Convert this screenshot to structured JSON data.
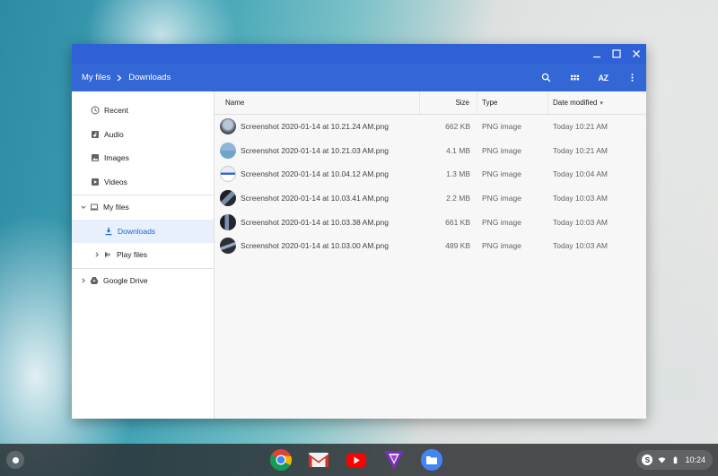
{
  "window": {
    "controls": {
      "minimize_icon": "minimize-icon",
      "maximize_icon": "maximize-icon",
      "close_icon": "close-icon"
    }
  },
  "breadcrumb": [
    "My files",
    "Downloads"
  ],
  "toolbar": {
    "az_label": "AZ",
    "icons": [
      "search-icon",
      "grid-view-icon",
      "sort-az-icon",
      "more-vert-icon"
    ]
  },
  "sidebar": {
    "recent": "Recent",
    "audio": "Audio",
    "images": "Images",
    "videos": "Videos",
    "my_files": "My files",
    "downloads": "Downloads",
    "play_files": "Play files",
    "google_drive": "Google Drive"
  },
  "columns": {
    "name": "Name",
    "size": "Size",
    "type": "Type",
    "date": "Date modified"
  },
  "files": [
    {
      "name": "Screenshot 2020-01-14 at 10.21.24 AM.png",
      "size": "662 KB",
      "type": "PNG image",
      "date": "Today 10:21 AM"
    },
    {
      "name": "Screenshot 2020-01-14 at 10.21.03 AM.png",
      "size": "4.1 MB",
      "type": "PNG image",
      "date": "Today 10:21 AM"
    },
    {
      "name": "Screenshot 2020-01-14 at 10.04.12 AM.png",
      "size": "1.3 MB",
      "type": "PNG image",
      "date": "Today 10:04 AM"
    },
    {
      "name": "Screenshot 2020-01-14 at 10.03.41 AM.png",
      "size": "2.2 MB",
      "type": "PNG image",
      "date": "Today 10:03 AM"
    },
    {
      "name": "Screenshot 2020-01-14 at 10.03.38 AM.png",
      "size": "661 KB",
      "type": "PNG image",
      "date": "Today 10:03 AM"
    },
    {
      "name": "Screenshot 2020-01-14 at 10.03.00 AM.png",
      "size": "489 KB",
      "type": "PNG image",
      "date": "Today 10:03 AM"
    }
  ],
  "shelf": {
    "apps": [
      "chrome-icon",
      "gmail-icon",
      "youtube-icon",
      "vectr-icon",
      "files-icon"
    ],
    "tray": {
      "s_badge": "S",
      "time": "10:24"
    }
  },
  "colors": {
    "accent": "#3367d6",
    "titlebar": "#2f61d6",
    "selected_bg": "#e8f0fe",
    "selected_text": "#1967d2"
  }
}
